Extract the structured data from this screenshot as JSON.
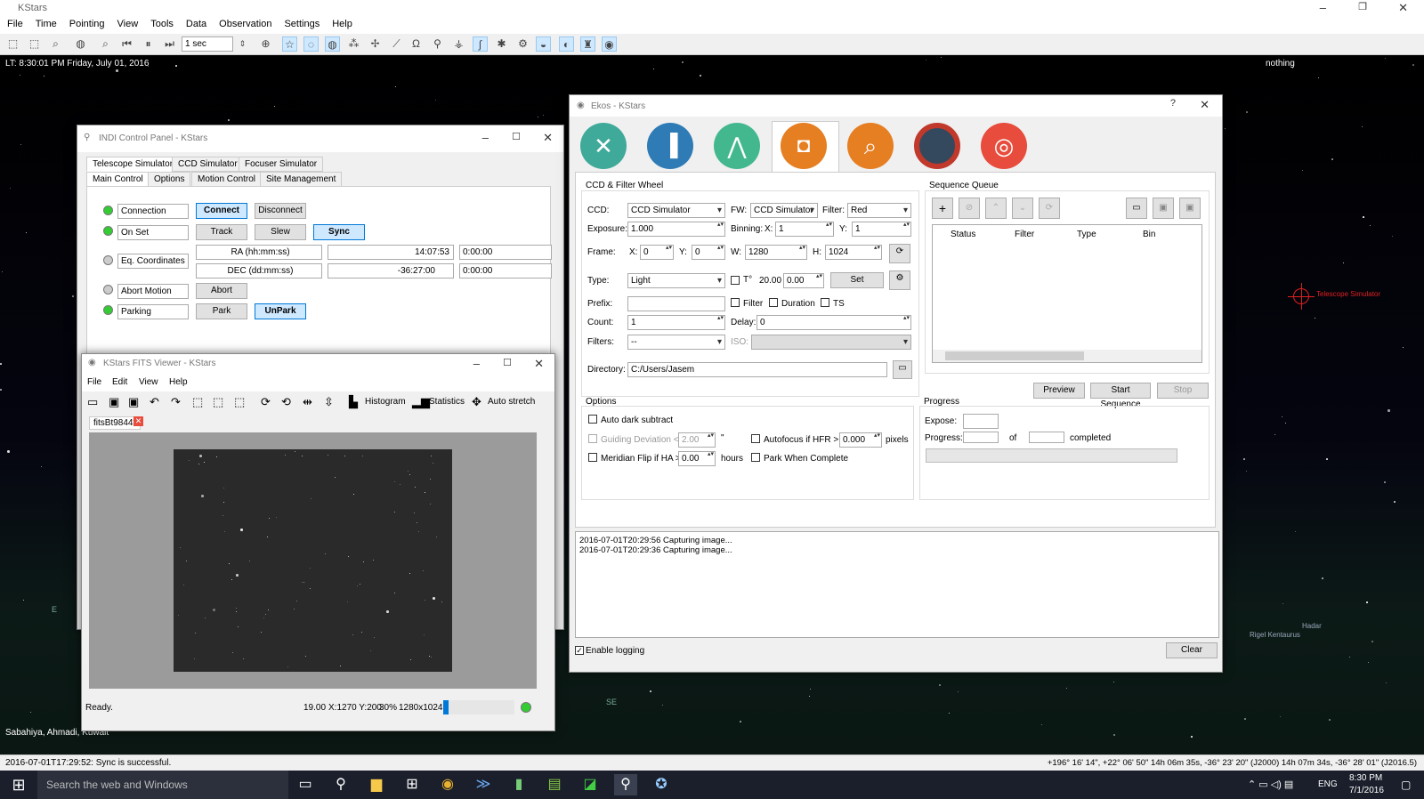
{
  "app": {
    "title": "KStars",
    "menu": [
      "File",
      "Time",
      "Pointing",
      "View",
      "Tools",
      "Data",
      "Observation",
      "Settings",
      "Help"
    ],
    "time_step": "1 sec"
  },
  "sky": {
    "lt": "LT: 8:30:01 PM  Friday, July 01, 2016",
    "focus": "nothing",
    "telescope_label": "Telescope Simulator",
    "location": "Sabahiya, Ahmadi, Kuwait",
    "labels": {
      "e": "E",
      "se": "SE",
      "hadar": "Hadar",
      "rigel": "Rigel Kentaurus"
    }
  },
  "status": {
    "message": "2016-07-01T17:29:52: Sync is successful.",
    "coords": "+196° 16' 14\", +22° 06' 50\"  14h 06m 35s, -36° 23' 20\" (J2000)  14h 07m 34s, -36° 28' 01\" (J2016.5)"
  },
  "taskbar": {
    "search": "Search the web and Windows",
    "lang": "ENG",
    "time": "8:30 PM",
    "date": "7/1/2016"
  },
  "indi": {
    "title": "INDI Control Panel - KStars",
    "device_tabs": [
      "Telescope Simulator",
      "CCD Simulator",
      "Focuser Simulator"
    ],
    "group_tabs": [
      "Main Control",
      "Options",
      "Motion Control",
      "Site Management"
    ],
    "connection": "Connection",
    "connect": "Connect",
    "disconnect": "Disconnect",
    "onset": "On Set",
    "track": "Track",
    "slew": "Slew",
    "sync": "Sync",
    "eqcoords": "Eq. Coordinates",
    "ra_label": "RA (hh:mm:ss)",
    "ra_value": "14:07:53",
    "ra_set": "0:00:00",
    "dec_label": "DEC (dd:mm:ss)",
    "dec_value": "-36:27:00",
    "dec_set": "0:00:00",
    "abort_motion": "Abort Motion",
    "abort": "Abort",
    "parking": "Parking",
    "park": "Park",
    "unpark": "UnPark"
  },
  "fits": {
    "title": "KStars FITS Viewer - KStars",
    "menu": [
      "File",
      "Edit",
      "View",
      "Help"
    ],
    "histogram": "Histogram",
    "statistics": "Statistics",
    "autostretch": "Auto stretch",
    "tab": "fitsBt9844*",
    "ready": "Ready.",
    "value": "19.00",
    "xy": "X:1270 Y:200",
    "zoom": "30%",
    "size": "1280x1024"
  },
  "ekos": {
    "title": "Ekos - KStars",
    "ccd_group": "CCD & Filter Wheel",
    "ccd_label": "CCD:",
    "ccd": "CCD Simulator",
    "fw_label": "FW:",
    "fw": "CCD Simulator",
    "filter_label": "Filter:",
    "filter": "Red",
    "exposure_label": "Exposure:",
    "exposure": "1.000",
    "binning_label": "Binning:",
    "x_label": "X:",
    "y_label": "Y:",
    "bin_x": "1",
    "bin_y": "1",
    "frame_label": "Frame:",
    "frame_x": "0",
    "frame_y": "0",
    "w_label": "W:",
    "frame_w": "1280",
    "h_label": "H:",
    "frame_h": "1024",
    "type_label": "Type:",
    "type": "Light",
    "temp_label": "T°",
    "temp": "20.00",
    "temp_set": "0.00",
    "set": "Set",
    "prefix_label": "Prefix:",
    "opt_filter": "Filter",
    "opt_duration": "Duration",
    "opt_ts": "TS",
    "count_label": "Count:",
    "count": "1",
    "delay_label": "Delay:",
    "delay": "0",
    "filters_label": "Filters:",
    "filters": "--",
    "iso_label": "ISO:",
    "directory_label": "Directory:",
    "directory": "C:/Users/Jasem",
    "queue_title": "Sequence Queue",
    "queue_cols": [
      "Status",
      "Filter",
      "Type",
      "Bin"
    ],
    "preview": "Preview",
    "start_sequence": "Start Sequence",
    "stop": "Stop",
    "options_title": "Options",
    "auto_dark": "Auto dark subtract",
    "guide_dev": "Guiding Deviation <",
    "guide_dev_val": "2.00",
    "guide_unit": "\"",
    "autofocus": "Autofocus if HFR >",
    "hfr_val": "0.000",
    "hfr_unit": "pixels",
    "meridian": "Meridian Flip if HA >",
    "ha_val": "0.00",
    "ha_unit": "hours",
    "park_complete": "Park When Complete",
    "progress_title": "Progress",
    "expose_label": "Expose:",
    "progress_label": "Progress:",
    "of": "of",
    "completed": "completed",
    "log": [
      "2016-07-01T20:29:56 Capturing image...",
      "2016-07-01T20:29:36 Capturing image..."
    ],
    "enable_logging": "Enable logging",
    "clear": "Clear"
  }
}
